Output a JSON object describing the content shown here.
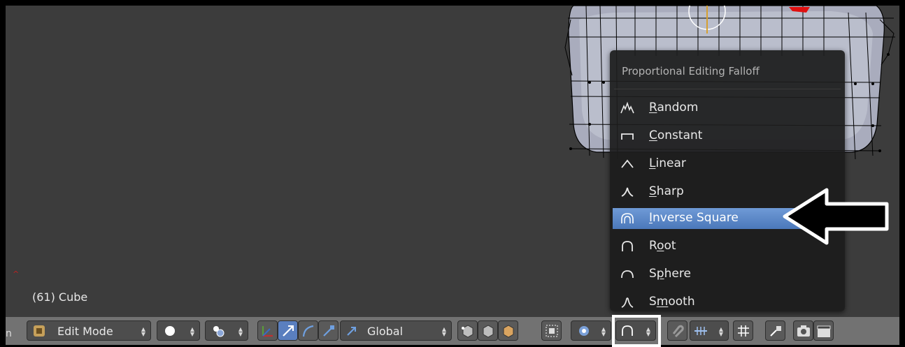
{
  "viewport": {
    "object_label": "(61) Cube",
    "axis_mark": "^"
  },
  "falloff_menu": {
    "title": "Proportional Editing Falloff",
    "items": [
      {
        "pre": "",
        "key": "R",
        "post": "andom",
        "icon": "random-falloff-icon"
      },
      {
        "pre": "",
        "key": "C",
        "post": "onstant",
        "icon": "constant-falloff-icon"
      },
      {
        "pre": "",
        "key": "L",
        "post": "inear",
        "icon": "linear-falloff-icon"
      },
      {
        "pre": "",
        "key": "S",
        "post": "harp",
        "icon": "sharp-falloff-icon"
      },
      {
        "pre": "",
        "key": "I",
        "post": "nverse Square",
        "icon": "inverse-square-falloff-icon",
        "selected": true
      },
      {
        "pre": "R",
        "key": "o",
        "post": "ot",
        "icon": "root-falloff-icon"
      },
      {
        "pre": "S",
        "key": "p",
        "post": "here",
        "icon": "sphere-falloff-icon"
      },
      {
        "pre": "S",
        "key": "m",
        "post": "ooth",
        "icon": "smooth-falloff-icon"
      }
    ]
  },
  "header": {
    "left_stub": "n",
    "mode": "Edit Mode",
    "orientation": "Global"
  },
  "colors": {
    "viewport_bg": "#3c3c3c",
    "menu_selected": "#5a86c8",
    "header_bg": "#727272",
    "mesh_wire": "#000000",
    "mesh_fill": "#b4b6c6"
  }
}
